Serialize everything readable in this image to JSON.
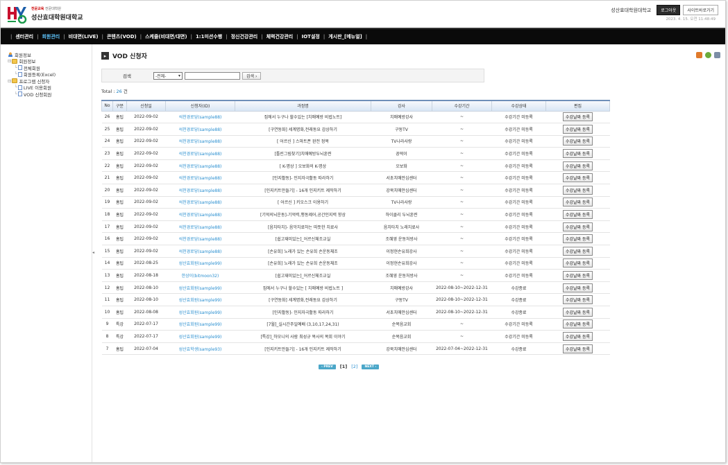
{
  "header": {
    "logo_sub_red": "전문교육",
    "logo_sub_rest": "전문대학원",
    "logo_name": "성산효대학원대학교",
    "org": "성산효대학원대학교",
    "logout_label": "로그아웃",
    "site_label": "사이트바로가기",
    "date": "2023. 4. 15. 오전 11:48:49"
  },
  "nav": [
    {
      "label": "센터관리",
      "active": false
    },
    {
      "label": "회원관리",
      "active": true
    },
    {
      "label": "비대면(LIVE)",
      "active": false
    },
    {
      "label": "콘텐츠(VOD)",
      "active": false
    },
    {
      "label": "스케줄(비대면/대면)",
      "active": false
    },
    {
      "label": "1:1미션수행",
      "active": false
    },
    {
      "label": "정신건강관리",
      "active": false
    },
    {
      "label": "체력건강관리",
      "active": false
    },
    {
      "label": "IOT설정",
      "active": false
    },
    {
      "label": "게시판_[메뉴얼]",
      "active": false
    }
  ],
  "sidebar": {
    "root": "회원정보",
    "group1": "회원정보",
    "group1_items": [
      "전체회원",
      "회원등록(Excel)"
    ],
    "group2": "프로그램 신청자",
    "group2_items": [
      "LIVE 이용회원",
      "VOD 신청회원"
    ]
  },
  "main": {
    "title": "VOD 신청자",
    "search_label": "검색",
    "search_select": "-전체-",
    "search_value": "",
    "search_button": "검색 ›",
    "total_label": "Total : ",
    "total_count": "26",
    "total_unit": " 건",
    "columns": [
      "No",
      "구분",
      "신청일",
      "신청자(ID)",
      "과정명",
      "강사",
      "수강기간",
      "수강상태",
      "편집"
    ],
    "edit_label": "수강날짜 등록",
    "rows": [
      {
        "no": "26",
        "type": "홈팁",
        "date": "2022-09-02",
        "user": "석천경로당(sample88)",
        "course": "집에서 누구나 할수있는 [치매예방 비법노트]",
        "teacher": "치매예방강사",
        "period": "~",
        "status": "수강기간 미등록"
      },
      {
        "no": "25",
        "type": "홈팁",
        "date": "2022-09-02",
        "user": "석천경로당(sample88)",
        "course": "[구연동화] 세계명화,전래동요 감상하기",
        "teacher": "구동TV",
        "period": "~",
        "status": "수강기간 미등록"
      },
      {
        "no": "24",
        "type": "홈팁",
        "date": "2022-09-02",
        "user": "석천경로당(sample88)",
        "course": "[ 어르신 ] 스마트폰 완전 정복",
        "teacher": "TV나라사랑",
        "period": "~",
        "status": "수강기간 미등록"
      },
      {
        "no": "23",
        "type": "홈팁",
        "date": "2022-09-02",
        "user": "석천경로당(sample88)",
        "course": "[틀린그림찾기]치매예방두뇌훈련",
        "teacher": "꽁떡이",
        "period": "~",
        "status": "수강기간 미등록"
      },
      {
        "no": "22",
        "type": "홈팁",
        "date": "2022-09-02",
        "user": "석천경로당(sample88)",
        "course": "[ K-명상 ] 오보화의 K-명상",
        "teacher": "오보화",
        "period": "~",
        "status": "수강기간 미등록"
      },
      {
        "no": "21",
        "type": "홈팁",
        "date": "2022-09-02",
        "user": "석천경로당(sample88)",
        "course": "[인지활동]- 인지자극활동 따라하기",
        "teacher": "서초치매안심센터",
        "period": "~",
        "status": "수강기간 미등록"
      },
      {
        "no": "20",
        "type": "홈팁",
        "date": "2022-09-02",
        "user": "석천경로당(sample88)",
        "course": "[인지키트만들기] - 16개 인지키트 제작하기",
        "teacher": "강북치매안심센터",
        "period": "~",
        "status": "수강기간 미등록"
      },
      {
        "no": "19",
        "type": "홈팁",
        "date": "2022-09-02",
        "user": "석천경로당(sample88)",
        "course": "[ 어르신 ] 키오스크 이용하기",
        "teacher": "TV나라사랑",
        "period": "~",
        "status": "수강기간 미등록"
      },
      {
        "no": "18",
        "type": "홈팁",
        "date": "2022-09-02",
        "user": "석천경로당(sample88)",
        "course": "[기억의뇌운동]-기억력,행동제어,공간인지력 향상",
        "teacher": "하이클리 두뇌훈련",
        "period": "~",
        "status": "수강기간 미등록"
      },
      {
        "no": "17",
        "type": "홈팁",
        "date": "2022-09-02",
        "user": "석천경로당(sample88)",
        "course": "[음치타치]- 음악치료하는 따뜻한 치료사",
        "teacher": "음치타치 노래치료사",
        "period": "~",
        "status": "수강기간 미등록"
      },
      {
        "no": "16",
        "type": "홈팁",
        "date": "2022-09-02",
        "user": "석천경로당(sample88)",
        "course": "[쉽고재미있는]_어르신체조교실",
        "teacher": "조혜영 운동처방사",
        "period": "~",
        "status": "수강기간 미등록"
      },
      {
        "no": "15",
        "type": "홈팁",
        "date": "2022-09-02",
        "user": "석천경로당(sample88)",
        "course": "[손유희] 노래가 있는 손유희 손운동체조",
        "teacher": "이정현손유희강사",
        "period": "~",
        "status": "수강기간 미등록"
      },
      {
        "no": "14",
        "type": "홈팁",
        "date": "2022-08-25",
        "user": "성산효회원(sample99)",
        "course": "[손유희] 노래가 있는 손유희 손운동체조",
        "teacher": "이정현손유희강사",
        "period": "~",
        "status": "수강기간 미등록"
      },
      {
        "no": "13",
        "type": "홈팁",
        "date": "2022-08-18",
        "user": "한상이(bitmoon32)",
        "course": "[쉽고재미있는]_어르신체조교실",
        "teacher": "조혜영 운동처방사",
        "period": "~",
        "status": "수강기간 미등록"
      },
      {
        "no": "12",
        "type": "홈팁",
        "date": "2022-08-10",
        "user": "성산효회원(sample99)",
        "course": "집에서 누구나 할수있는 [ 치매예방 비법노트 ]",
        "teacher": "치매예방강사",
        "period": "2022-08-10~2022-12-31",
        "status": "수강종료"
      },
      {
        "no": "11",
        "type": "홈팁",
        "date": "2022-08-10",
        "user": "성산효회원(sample99)",
        "course": "[구연동화] 세계명화,전래동요 감상하기",
        "teacher": "구동TV",
        "period": "2022-08-10~2022-12-31",
        "status": "수강종료"
      },
      {
        "no": "10",
        "type": "홈팁",
        "date": "2022-08-08",
        "user": "성산효회원(sample99)",
        "course": "[인지활동]- 인지자극활동 따라하기",
        "teacher": "서초치매안심센터",
        "period": "2022-08-10~2022-12-31",
        "status": "수강종료"
      },
      {
        "no": "9",
        "type": "특강",
        "date": "2022-07-17",
        "user": "성산효회원(sample99)",
        "course": "[7월]_실시간주일예배 (3,10,17,24,31)",
        "teacher": "순복음교회",
        "period": "~",
        "status": "수강기간 미등록"
      },
      {
        "no": "8",
        "type": "특강",
        "date": "2022-07-17",
        "user": "성산효회원(sample99)",
        "course": "[특강]_하모니의 사람 최성규 목사의 목회 이야기",
        "teacher": "순복음교회",
        "period": "~",
        "status": "수강기간 미등록"
      },
      {
        "no": "7",
        "type": "홈팁",
        "date": "2022-07-04",
        "user": "성산효학생(sample93)",
        "course": "[인지키트만들기] - 16개 인지키트 제작하기",
        "teacher": "강북치매안심센터",
        "period": "2022-07-04~2022-12-31",
        "status": "수강종료"
      }
    ]
  },
  "pager": {
    "prev": "‹ PREV",
    "current": "[1]",
    "pages": [
      "[2]"
    ],
    "next": "NEXT ›"
  }
}
